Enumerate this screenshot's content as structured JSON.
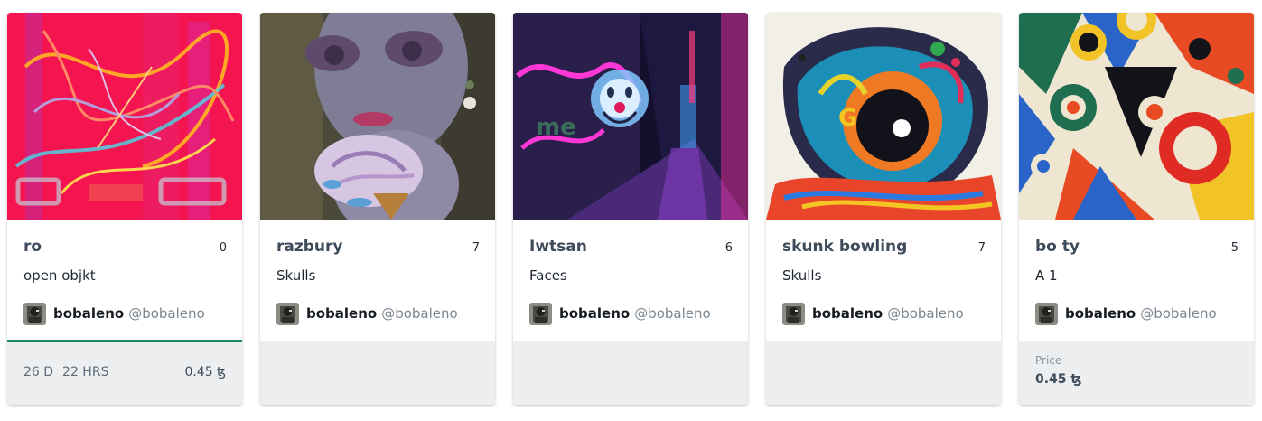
{
  "cards": [
    {
      "title": "ro",
      "editions": "0",
      "collection": "open objkt",
      "artist_name": "bobaleno",
      "artist_handle": "@bobaleno",
      "countdown_days": "26 D",
      "countdown_hours": "22 HRS",
      "price": "0.45 ꜩ"
    },
    {
      "title": "razbury",
      "editions": "7",
      "collection": "Skulls",
      "artist_name": "bobaleno",
      "artist_handle": "@bobaleno"
    },
    {
      "title": "Iwtsan",
      "editions": "6",
      "collection": "Faces",
      "artist_name": "bobaleno",
      "artist_handle": "@bobaleno"
    },
    {
      "title": "skunk bowling",
      "editions": "7",
      "collection": "Skulls",
      "artist_name": "bobaleno",
      "artist_handle": "@bobaleno"
    },
    {
      "title": "bo ty",
      "editions": "5",
      "collection": "A 1",
      "artist_name": "bobaleno",
      "artist_handle": "@bobaleno",
      "price_label": "Price",
      "price": "0.45 ꜩ"
    }
  ],
  "colors": {
    "timer_bar": "#1a8a5e",
    "footer_bg": "#eceef0",
    "title_text": "#3d4b5a"
  }
}
